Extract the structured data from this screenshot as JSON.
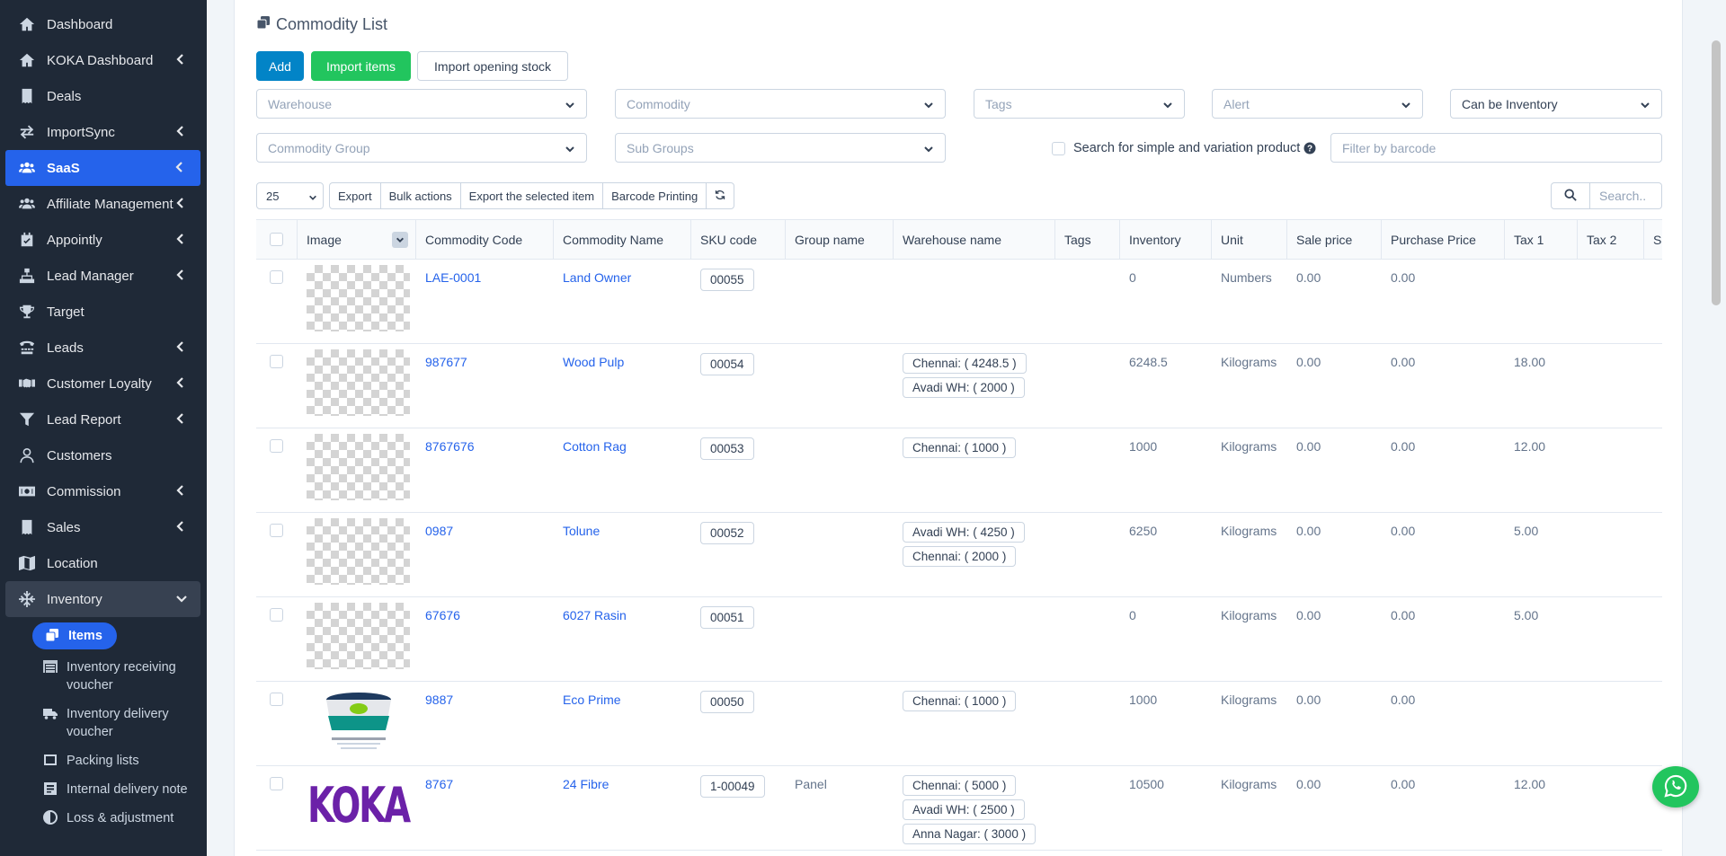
{
  "sidebar": {
    "items": [
      {
        "label": "Dashboard",
        "icon": "home-icon",
        "chev": false
      },
      {
        "label": "KOKA Dashboard",
        "icon": "home-icon",
        "chev": true
      },
      {
        "label": "Deals",
        "icon": "receipt-icon",
        "chev": false
      },
      {
        "label": "ImportSync",
        "icon": "exchange-icon",
        "chev": true
      },
      {
        "label": "SaaS",
        "icon": "users-icon",
        "chev": true,
        "active": true
      },
      {
        "label": "Affiliate Management",
        "icon": "users-icon",
        "chev": true
      },
      {
        "label": "Appointly",
        "icon": "calendar-icon",
        "chev": true
      },
      {
        "label": "Lead Manager",
        "icon": "sitemap-icon",
        "chev": true
      },
      {
        "label": "Target",
        "icon": "trophy-icon",
        "chev": false
      },
      {
        "label": "Leads",
        "icon": "tty-icon",
        "chev": true
      },
      {
        "label": "Customer Loyalty",
        "icon": "handshake-icon",
        "chev": true
      },
      {
        "label": "Lead Report",
        "icon": "filter-icon",
        "chev": true
      },
      {
        "label": "Customers",
        "icon": "user-icon",
        "chev": false
      },
      {
        "label": "Commission",
        "icon": "money-icon",
        "chev": true
      },
      {
        "label": "Sales",
        "icon": "receipt-icon",
        "chev": true
      },
      {
        "label": "Location",
        "icon": "map-icon",
        "chev": false
      },
      {
        "label": "Inventory",
        "icon": "snowflake-icon",
        "chev": true,
        "open": true
      }
    ],
    "subitems": [
      {
        "label": "Items",
        "icon": "clone-icon",
        "active": true
      },
      {
        "label": "Inventory receiving voucher",
        "icon": "warehouse-icon"
      },
      {
        "label": "Inventory delivery voucher",
        "icon": "truck-icon"
      },
      {
        "label": "Packing lists",
        "icon": "box-icon"
      },
      {
        "label": "Internal delivery note",
        "icon": "note-icon"
      },
      {
        "label": "Loss & adjustment",
        "icon": "adjust-icon"
      }
    ]
  },
  "page": {
    "title": "Commodity List",
    "buttons": {
      "add": "Add",
      "import_items": "Import items",
      "import_opening_stock": "Import opening stock"
    },
    "filters": {
      "warehouse": "Warehouse",
      "commodity": "Commodity",
      "tags": "Tags",
      "alert": "Alert",
      "can_be": "Can be Inventory",
      "commodity_group": "Commodity Group",
      "sub_groups": "Sub Groups",
      "search_simple": "Search for simple and variation product",
      "barcode_placeholder": "Filter by barcode"
    },
    "toolbar": {
      "page_size": "25",
      "export": "Export",
      "bulk": "Bulk actions",
      "export_selected": "Export the selected item",
      "barcode_print": "Barcode Printing",
      "search_placeholder": "Search.."
    }
  },
  "table": {
    "headers": [
      "Image",
      "Commodity Code",
      "Commodity Name",
      "SKU code",
      "Group name",
      "Warehouse name",
      "Tags",
      "Inventory",
      "Unit",
      "Sale price",
      "Purchase Price",
      "Tax 1",
      "Tax 2",
      "S"
    ],
    "rows": [
      {
        "img": "checker",
        "code": "LAE-0001",
        "name": "Land Owner",
        "sku": "00055",
        "group": "",
        "wh": [],
        "inv": "0",
        "unit": "Numbers",
        "sale": "0.00",
        "purchase": "0.00",
        "tax1": ""
      },
      {
        "img": "checker",
        "code": "987677",
        "name": "Wood Pulp",
        "sku": "00054",
        "group": "",
        "wh": [
          "Chennai: ( 4248.5 )",
          "Avadi WH: ( 2000 )"
        ],
        "inv": "6248.5",
        "unit": "Kilograms",
        "sale": "0.00",
        "purchase": "0.00",
        "tax1": "18.00"
      },
      {
        "img": "checker",
        "code": "8767676",
        "name": "Cotton Rag",
        "sku": "00053",
        "group": "",
        "wh": [
          "Chennai: ( 1000 )"
        ],
        "inv": "1000",
        "unit": "Kilograms",
        "sale": "0.00",
        "purchase": "0.00",
        "tax1": "12.00"
      },
      {
        "img": "checker",
        "code": "0987",
        "name": "Tolune",
        "sku": "00052",
        "group": "",
        "wh": [
          "Avadi WH: ( 4250 )",
          "Chennai: ( 2000 )"
        ],
        "inv": "6250",
        "unit": "Kilograms",
        "sale": "0.00",
        "purchase": "0.00",
        "tax1": "5.00"
      },
      {
        "img": "checker",
        "code": "67676",
        "name": "6027 Rasin",
        "sku": "00051",
        "group": "",
        "wh": [],
        "inv": "0",
        "unit": "Kilograms",
        "sale": "0.00",
        "purchase": "0.00",
        "tax1": "5.00"
      },
      {
        "img": "product",
        "code": "9887",
        "name": "Eco Prime",
        "sku": "00050",
        "group": "",
        "wh": [
          "Chennai: ( 1000 )"
        ],
        "inv": "1000",
        "unit": "Kilograms",
        "sale": "0.00",
        "purchase": "0.00",
        "tax1": ""
      },
      {
        "img": "koka",
        "img_text": "KOKA",
        "code": "8767",
        "name": "24 Fibre",
        "sku": "1-00049",
        "group": "Panel",
        "wh": [
          "Chennai: ( 5000 )",
          "Avadi WH: ( 2500 )",
          "Anna Nagar: ( 3000 )"
        ],
        "inv": "10500",
        "unit": "Kilograms",
        "sale": "0.00",
        "purchase": "0.00",
        "tax1": "12.00"
      }
    ]
  },
  "colors": {
    "sidebar": "#1f2937",
    "accent": "#2563eb",
    "success": "#22c55e",
    "whatsapp": "#22c55e"
  }
}
